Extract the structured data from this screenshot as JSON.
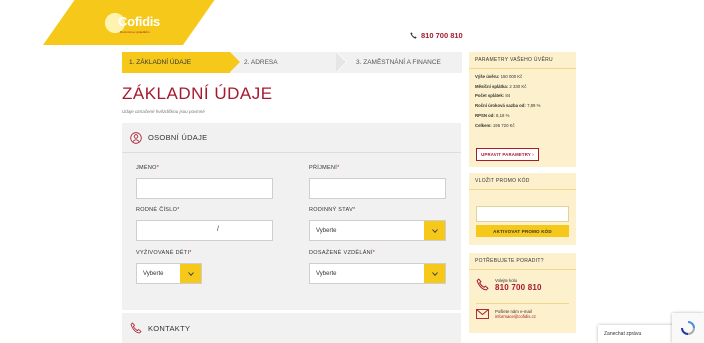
{
  "logo": {
    "text": "Cofidis",
    "tagline": "Rozumíme výsledkům"
  },
  "header": {
    "phone": "810 700 810"
  },
  "steps": [
    {
      "label": "1. ZÁKLADNÍ ÚDAJE",
      "active": true
    },
    {
      "label": "2. ADRESA",
      "active": false
    },
    {
      "label": "3. ZAMĚSTNÁNÍ A FINANCE",
      "active": false
    }
  ],
  "page": {
    "title": "ZÁKLADNÍ ÚDAJE",
    "required_note": "Údaje označené hvězdičkou jsou povinné"
  },
  "personal": {
    "heading": "OSOBNÍ ÚDAJE",
    "first_name_label": "JMÉNO",
    "last_name_label": "PŘÍJMENÍ",
    "birth_number_label": "RODNÉ ČÍSLO",
    "birth_number_sep": "/",
    "marital_label": "RODINNÝ STAV",
    "marital_value": "Vyberte",
    "children_label": "VYŽIVOVANÉ DĚTI",
    "children_value": "Vyberte",
    "education_label": "DOSAŽENÉ VZDĚLÁNÍ",
    "education_value": "Vyberte",
    "required_mark": "*"
  },
  "contacts": {
    "heading": "KONTAKTY"
  },
  "loan_params": {
    "heading": "PARAMETRY VAŠEHO ÚVĚRU",
    "rows": [
      {
        "label": "Výše úvěru:",
        "value": "150 000 Kč"
      },
      {
        "label": "Měsíční splátka:",
        "value": "2 330 Kč"
      },
      {
        "label": "Počet splátek:",
        "value": "84"
      },
      {
        "label": "Roční úroková sazba od:",
        "value": "7,89 %"
      },
      {
        "label": "RPSN od:",
        "value": "8,18 %"
      },
      {
        "label": "Celkem:",
        "value": "195 720 Kč"
      }
    ],
    "button": "UPRAVIT PARAMETRY ›"
  },
  "promo": {
    "heading": "VLOŽIT PROMO KÓD",
    "button": "AKTIVOVAT PROMO KÓD"
  },
  "help": {
    "heading": "POTŘEBUJETE PORADIT?",
    "call_label": "Volejte kolu",
    "call_number": "810 700 810",
    "mail_label": "Pošlete nám e-mail",
    "mail_address": "informace@cofidis.cz"
  },
  "chat": {
    "label": "Zanechat zprávu"
  },
  "colors": {
    "brand_red": "#a6192e",
    "brand_yellow": "#f6c81a",
    "panel_gray": "#f1f1f1",
    "sidebar_cream": "#fcf1cc"
  }
}
